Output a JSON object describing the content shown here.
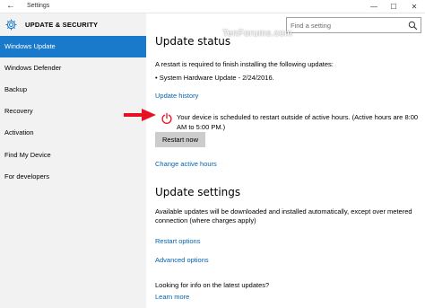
{
  "window": {
    "back_glyph": "←",
    "title": "Settings",
    "minimize_glyph": "—",
    "maximize_glyph": "☐",
    "close_glyph": "✕"
  },
  "header": {
    "icon": "gear-icon",
    "title": "UPDATE & SECURITY"
  },
  "search": {
    "placeholder": "Find a setting",
    "icon": "search-icon"
  },
  "sidebar": {
    "items": [
      {
        "label": "Windows Update",
        "selected": true
      },
      {
        "label": "Windows Defender",
        "selected": false
      },
      {
        "label": "Backup",
        "selected": false
      },
      {
        "label": "Recovery",
        "selected": false
      },
      {
        "label": "Activation",
        "selected": false
      },
      {
        "label": "Find My Device",
        "selected": false
      },
      {
        "label": "For developers",
        "selected": false
      }
    ]
  },
  "update_status": {
    "heading": "Update status",
    "watermark": "TenForums.com",
    "restart_required": "A restart is required to finish installing the following updates:",
    "update_item": "• System Hardware Update - 2/24/2016.",
    "history_link": "Update history",
    "scheduled_message": "Your device is scheduled to restart outside of active hours. (Active hours are 8:00 AM to 5:00 PM.)",
    "restart_button": "Restart now",
    "active_hours_link": "Change active hours"
  },
  "update_settings": {
    "heading": "Update settings",
    "description": "Available updates will be downloaded and installed automatically, except over metered connection (where charges apply)",
    "restart_options_link": "Restart options",
    "advanced_options_link": "Advanced options"
  },
  "info": {
    "text": "Looking for info on the latest updates?",
    "learn_more_link": "Learn more"
  },
  "colors": {
    "accent": "#1979ca",
    "link": "#0063b1",
    "sidebar_bg": "#f2f2f2",
    "power_icon": "#e81123",
    "annotation_arrow": "#e81123"
  }
}
